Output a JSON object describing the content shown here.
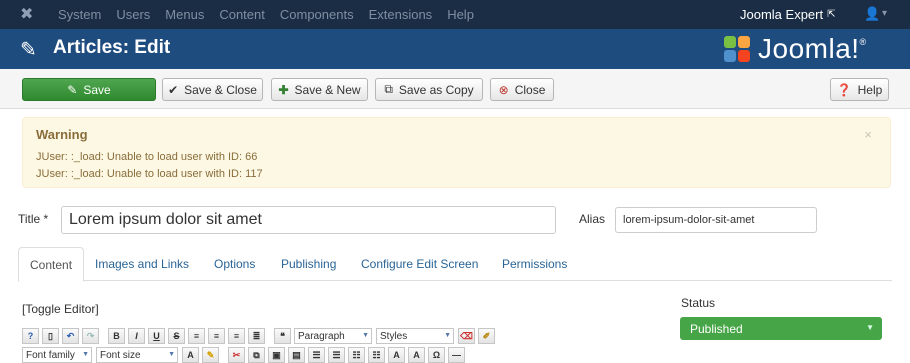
{
  "topnav": {
    "menu": [
      "System",
      "Users",
      "Menus",
      "Content",
      "Components",
      "Extensions",
      "Help"
    ],
    "user_label": "Joomla Expert"
  },
  "header": {
    "title": "Articles: Edit",
    "brand": "Joomla!"
  },
  "toolbar": {
    "save": "Save",
    "save_close": "Save & Close",
    "save_new": "Save & New",
    "save_copy": "Save as Copy",
    "close": "Close",
    "help": "Help"
  },
  "alert": {
    "heading": "Warning",
    "lines": [
      "JUser: :_load: Unable to load user with ID: 66",
      "JUser: :_load: Unable to load user with ID: 117"
    ],
    "close": "×"
  },
  "form": {
    "title_label": "Title *",
    "title_value": "Lorem ipsum dolor sit amet",
    "alias_label": "Alias",
    "alias_value": "lorem-ipsum-dolor-sit-amet"
  },
  "tabs": [
    "Content",
    "Images and Links",
    "Options",
    "Publishing",
    "Configure Edit Screen",
    "Permissions"
  ],
  "editor": {
    "toggle": "[Toggle Editor]",
    "format_select": "Paragraph",
    "styles_select": "Styles",
    "font_family": "Font family",
    "font_size": "Font size"
  },
  "sidebar": {
    "status_label": "Status",
    "status_value": "Published"
  },
  "colors": {
    "topnav_bg": "#1a2d44",
    "header_bg": "#1f4c7e",
    "save_green": "#3c9a3c",
    "status_green": "#46a546",
    "warning_bg": "#fcf8e3",
    "link_blue": "#2a6496"
  }
}
